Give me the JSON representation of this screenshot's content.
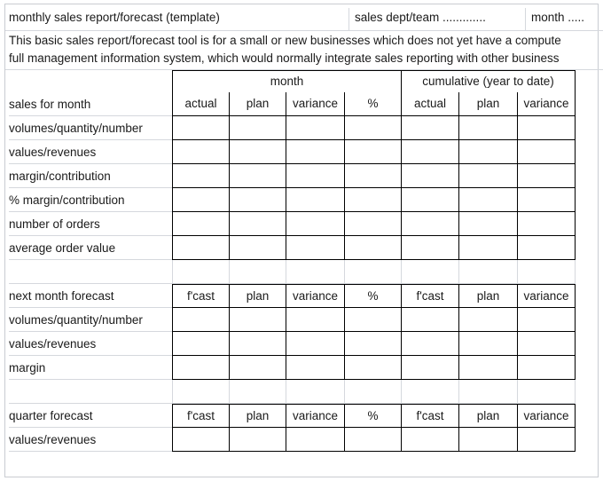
{
  "page": {
    "title": "monthly sales report/forecast (template)",
    "dept_field": "sales dept/team .............",
    "month_field": "month  ....."
  },
  "intro": {
    "line1": "This basic sales report/forecast tool is for a small or new businesses which does not yet have a compute",
    "line2": "full  management information system, which would normally integrate sales reporting with other business"
  },
  "group_headers": {
    "month": "month",
    "cumulative": "cumulative (year to date)"
  },
  "sections": [
    {
      "id": "sales-for-month",
      "header_label": "sales for month",
      "column_headers": [
        "actual",
        "plan",
        "variance",
        "%",
        "actual",
        "plan",
        "variance"
      ],
      "rows": [
        "volumes/quantity/number",
        "values/revenues",
        "margin/contribution",
        "% margin/contribution",
        "number of orders",
        "average order value"
      ]
    },
    {
      "id": "next-month-forecast",
      "header_label": "next month forecast",
      "column_headers": [
        "f'cast",
        "plan",
        "variance",
        "%",
        "f'cast",
        "plan",
        "variance"
      ],
      "rows": [
        "volumes/quantity/number",
        "values/revenues",
        "margin"
      ]
    },
    {
      "id": "quarter-forecast",
      "header_label": "quarter forecast",
      "column_headers": [
        "f'cast",
        "plan",
        "variance",
        "%",
        "f'cast",
        "plan",
        "variance"
      ],
      "rows": [
        "values/revenues"
      ]
    }
  ],
  "colors": {
    "grid_dark": "#000000",
    "grid_light": "#d5d8dd",
    "text": "#1a1a1a",
    "background": "#ffffff"
  }
}
